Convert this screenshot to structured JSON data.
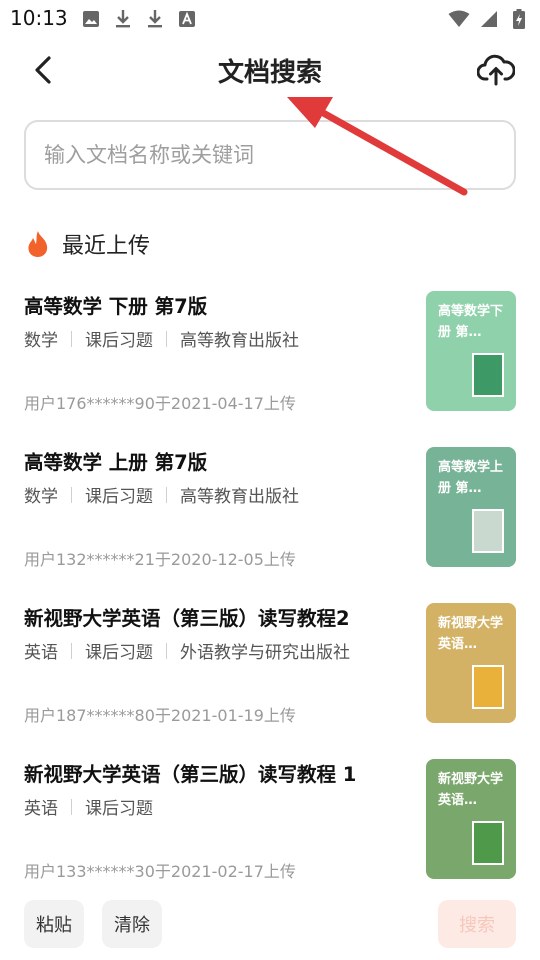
{
  "status_bar": {
    "time": "10:13",
    "left_icons": [
      "image-icon",
      "download-icon",
      "download-icon",
      "font-a-icon"
    ],
    "right_icons": [
      "wifi-icon",
      "signal-icon",
      "battery-charging-icon"
    ]
  },
  "header": {
    "title": "文档搜索",
    "back_icon": "chevron-left-icon",
    "upload_icon": "cloud-upload-icon"
  },
  "search": {
    "placeholder": "输入文档名称或关键词",
    "value": ""
  },
  "recent": {
    "title": "最近上传",
    "icon": "flame-icon",
    "accent": "#f2622b",
    "items": [
      {
        "title": "高等数学 下册 第7版",
        "subject": "数学",
        "category": "课后习题",
        "publisher": "高等教育出版社",
        "uploader": "用户176******90于2021-04-17上传",
        "thumb_text": "高等数学下册 第…",
        "thumb_color": "#8fd1ab"
      },
      {
        "title": "高等数学 上册 第7版",
        "subject": "数学",
        "category": "课后习题",
        "publisher": "高等教育出版社",
        "uploader": "用户132******21于2020-12-05上传",
        "thumb_text": "高等数学上册 第…",
        "thumb_color": "#77b396"
      },
      {
        "title": "新视野大学英语（第三版）读写教程2",
        "subject": "英语",
        "category": "课后习题",
        "publisher": "外语教学与研究出版社",
        "uploader": "用户187******80于2021-01-19上传",
        "thumb_text": "新视野大学英语…",
        "thumb_color": "#d3b265"
      },
      {
        "title": "新视野大学英语（第三版）读写教程 1",
        "subject": "英语",
        "category": "课后习题",
        "publisher": "",
        "uploader": "用户133******30于2021-02-17上传",
        "thumb_text": "新视野大学英语…",
        "thumb_color": "#7aa76b"
      }
    ]
  },
  "bottom": {
    "paste": "粘贴",
    "clear": "清除",
    "search": "搜索"
  },
  "colors": {
    "annotation_arrow": "#e03a3a",
    "search_button_bg": "#fdeae5"
  }
}
